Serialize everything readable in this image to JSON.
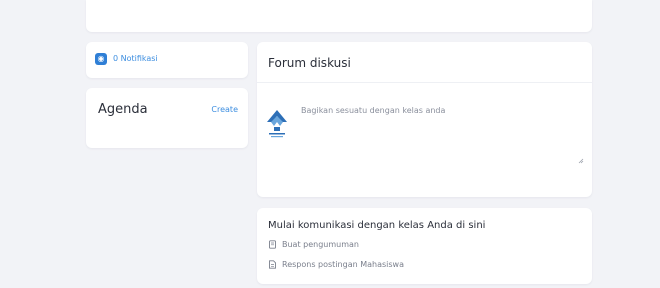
{
  "notifications": {
    "label": "0 Notifikasi",
    "badge_icon": "bell-icon"
  },
  "agenda": {
    "title": "Agenda",
    "create_label": "Create"
  },
  "forum": {
    "title": "Forum diskusi",
    "placeholder": "Bagikan sesuatu dengan kelas anda",
    "avatar_icon": "school-logo-icon"
  },
  "start": {
    "title": "Mulai komunikasi dengan kelas Anda di sini",
    "actions": [
      {
        "label": "Buat pengumuman",
        "icon": "document-icon"
      },
      {
        "label": "Respons postingan Mahasiswa",
        "icon": "file-text-icon"
      }
    ]
  },
  "colors": {
    "accent": "#3d8ee0",
    "badge": "#2f7fd6",
    "background": "#f2f3f7"
  }
}
